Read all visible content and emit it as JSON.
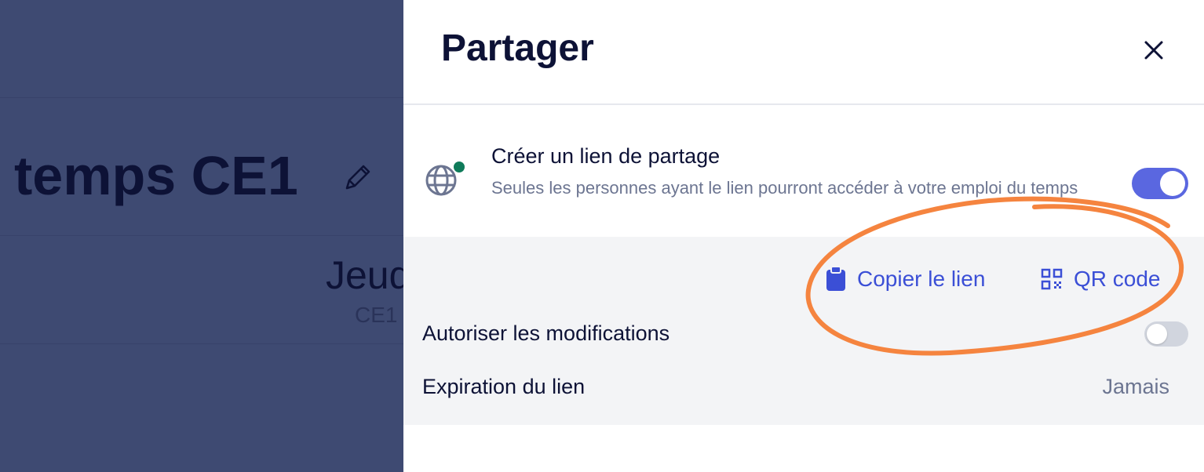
{
  "background_page": {
    "title": "temps CE1",
    "day": "Jeud",
    "class": "CE1"
  },
  "share_panel": {
    "title": "Partager",
    "share_link": {
      "title": "Créer un lien de partage",
      "description": "Seules les personnes ayant le lien pourront accéder à votre emploi du temps",
      "enabled": true
    },
    "actions": {
      "copy_link": "Copier le lien",
      "qr_code": "QR code"
    },
    "allow_edits": {
      "label": "Autoriser les modifications",
      "enabled": false
    },
    "expiration": {
      "label": "Expiration du lien",
      "value": "Jamais"
    }
  },
  "colors": {
    "overlay": "#3e4a72",
    "accent": "#5a67e0",
    "link": "#3b4fd6",
    "annotation": "#f5843f",
    "status_dot": "#0f7b5a"
  },
  "icons": [
    "pencil-icon",
    "close-icon",
    "globe-icon",
    "clipboard-icon",
    "qr-code-icon"
  ]
}
